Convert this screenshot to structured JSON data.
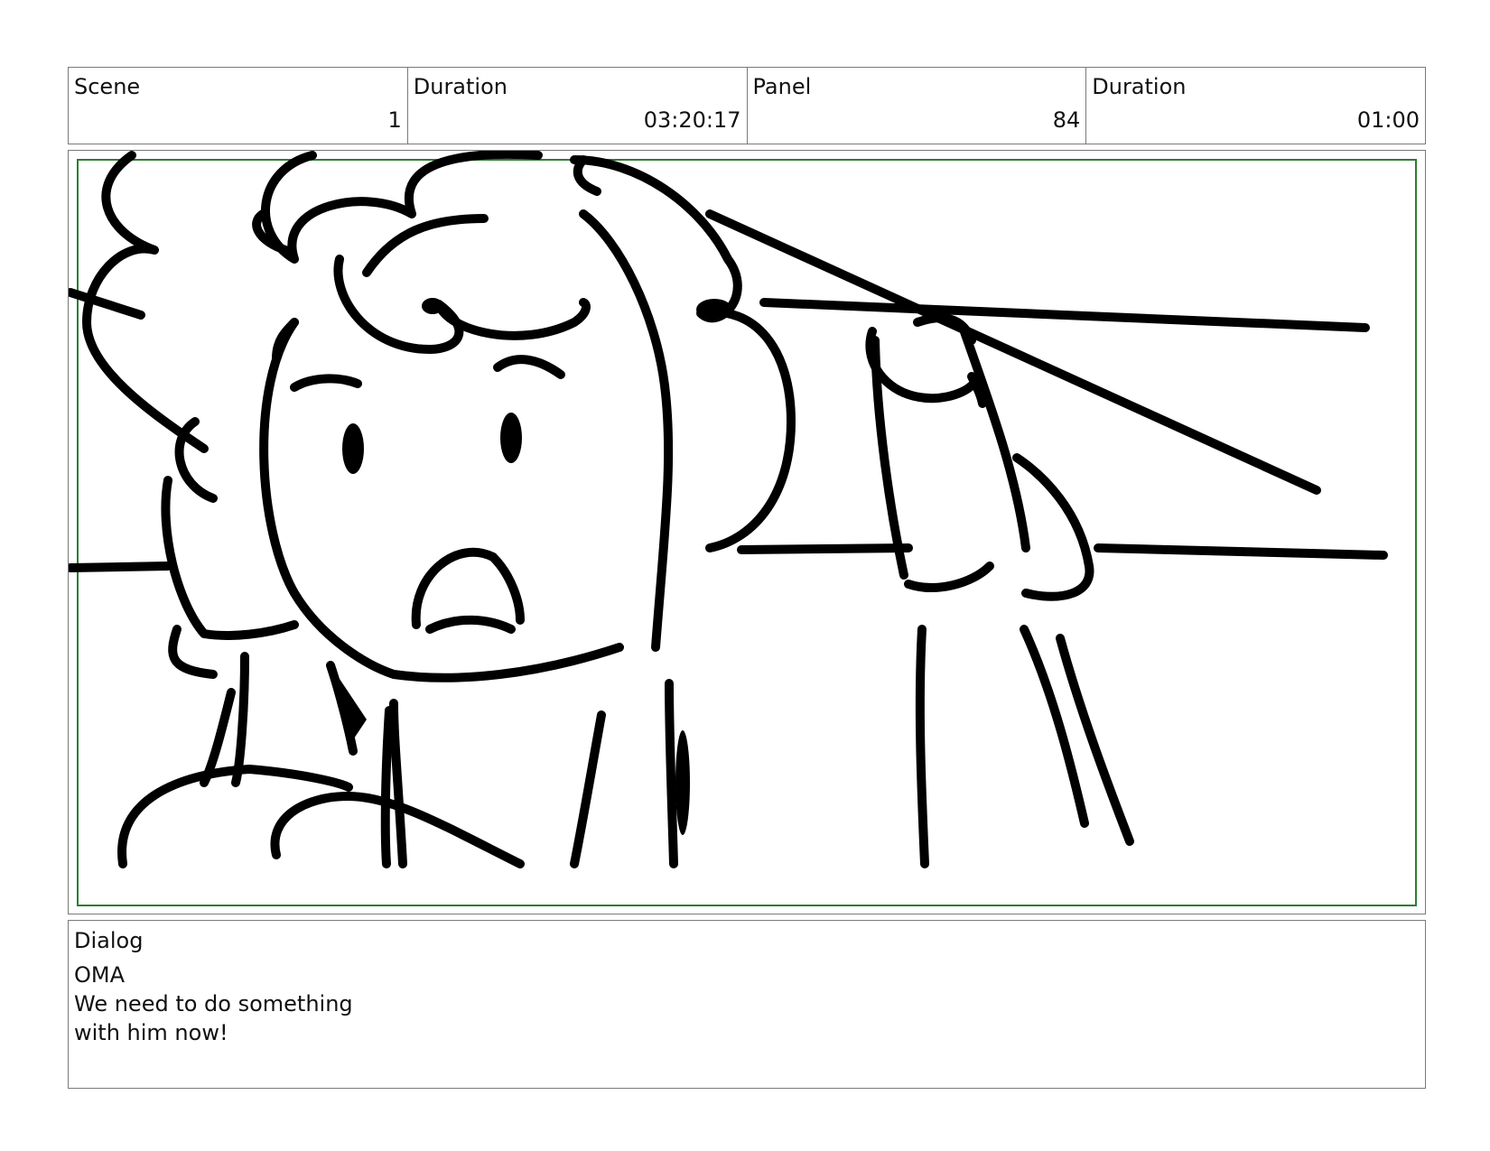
{
  "header": {
    "scene_label": "Scene",
    "scene_value": "1",
    "scene_duration_label": "Duration",
    "scene_duration_value": "03:20:17",
    "panel_label": "Panel",
    "panel_value": "84",
    "panel_duration_label": "Duration",
    "panel_duration_value": "01:00"
  },
  "panel": {
    "safe_area_color": "#2e7d32",
    "line_color": "#000000"
  },
  "dialog": {
    "label": "Dialog",
    "lines": [
      "OMA",
      "We need to do something",
      "with him now!"
    ]
  }
}
